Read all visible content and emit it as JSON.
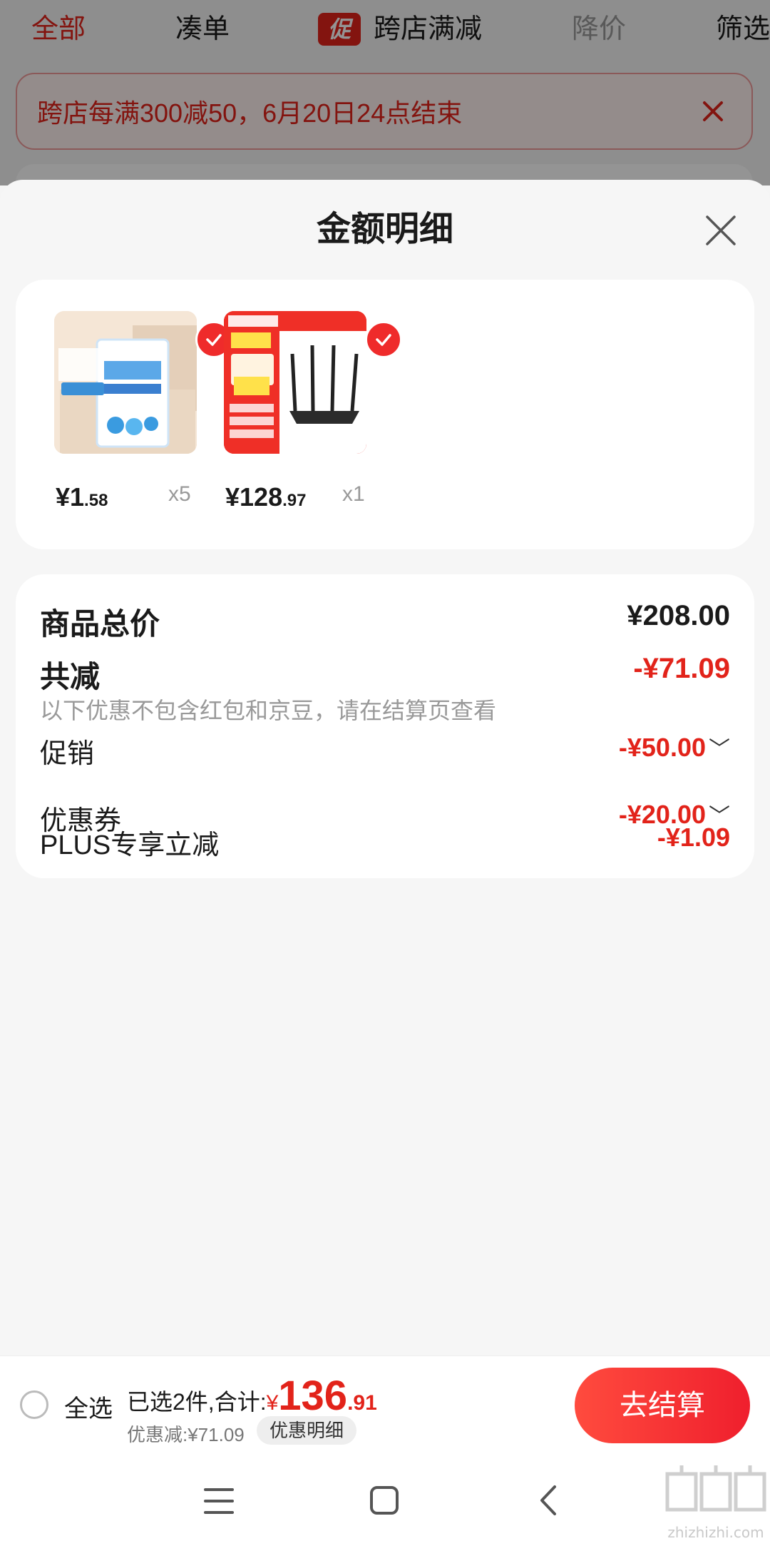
{
  "filter_tabs": {
    "all": "全部",
    "coudan": "凑单",
    "promo_badge": "促",
    "kuadian": "跨店满减",
    "price_down": "降价",
    "filter": "筛选"
  },
  "notice": {
    "text": "跨店每满300减50，6月20日24点结束",
    "close_icon": "close-icon"
  },
  "sheet": {
    "title": "金额明细",
    "close_icon": "close-icon"
  },
  "products": [
    {
      "price_int": "¥1",
      "price_dec": ".58",
      "qty": "x5",
      "image_label": "sponge-product-image"
    },
    {
      "price_int": "¥128",
      "price_dec": ".97",
      "qty": "x1",
      "image_label": "router-product-image"
    }
  ],
  "summary": {
    "total_label": "商品总价",
    "total_value": "¥208.00",
    "reduce_label": "共减",
    "reduce_value": "-¥71.09",
    "note": "以下优惠不包含红包和京豆，请在结算页查看",
    "items": [
      {
        "label": "促销",
        "value": "-¥50.00"
      },
      {
        "label": "优惠券",
        "value": "-¥20.00"
      },
      {
        "label": "PLUS专享立减",
        "value": "-¥1.09"
      }
    ]
  },
  "bottom_bar": {
    "select_all": "全选",
    "selected_text": "已选2件,合计:",
    "currency": "¥",
    "total_int": "136",
    "total_dec": ".91",
    "discount_text": "优惠减:¥71.09",
    "detail_chip": "优惠明细",
    "checkout": "去结算"
  },
  "nav": {
    "menu_icon": "menu-icon",
    "home_icon": "home-icon",
    "back_icon": "back-icon"
  },
  "watermark": {
    "text": "zhizhizhi.com"
  },
  "colors": {
    "accent_red": "#e2231a",
    "button_red": "#ef1f2d"
  }
}
